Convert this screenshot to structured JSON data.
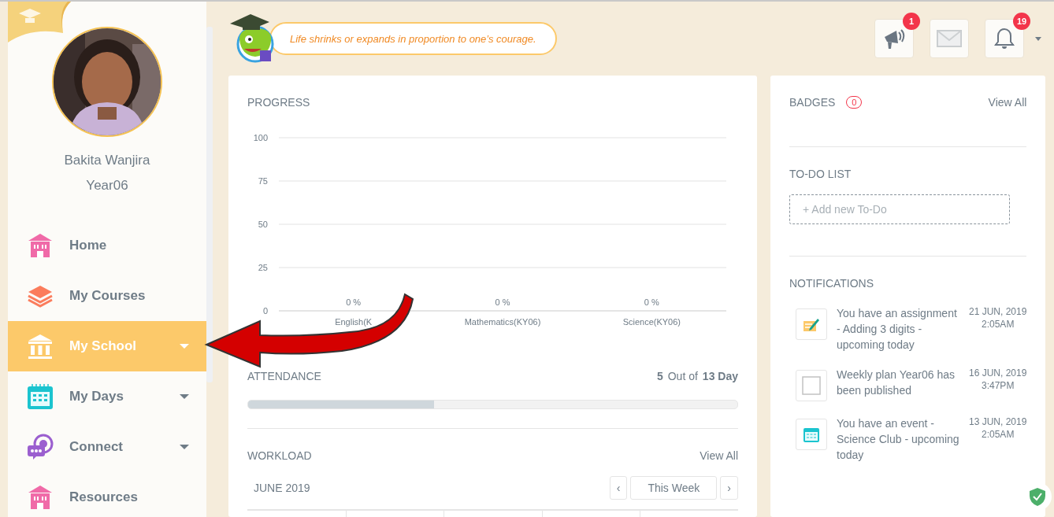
{
  "profile": {
    "name": "Bakita Wanjira",
    "class": "Year06"
  },
  "sidebar": {
    "items": [
      {
        "label": "Home",
        "selected": false,
        "expandable": false
      },
      {
        "label": "My Courses",
        "selected": false,
        "expandable": false
      },
      {
        "label": "My School",
        "selected": true,
        "expandable": true
      },
      {
        "label": "My Days",
        "selected": false,
        "expandable": true
      },
      {
        "label": "Connect",
        "selected": false,
        "expandable": true
      },
      {
        "label": "Resources",
        "selected": false,
        "expandable": false
      }
    ]
  },
  "header": {
    "quote": "Life shrinks or expands in proportion to one’s courage.",
    "buttons": [
      {
        "kind": "announcements",
        "badge": "1"
      },
      {
        "kind": "messages"
      },
      {
        "kind": "notifications",
        "badge": "19"
      }
    ]
  },
  "progress": {
    "title": "PROGRESS",
    "chart_data": {
      "type": "bar",
      "categories": [
        "English(K",
        "Mathematics(KY06)",
        "Science(KY06)"
      ],
      "values": [
        0,
        0,
        0
      ],
      "grid": true,
      "ylim": [
        0,
        100
      ],
      "yticks": [
        0,
        25,
        50,
        75,
        100
      ],
      "value_labels": [
        "0 %",
        "0 %",
        "0 %"
      ]
    }
  },
  "attendance": {
    "title": "ATTENDANCE",
    "present": "5",
    "separator": "Out of",
    "total": "13 Day",
    "level": 0.38
  },
  "workload": {
    "title": "WORKLOAD",
    "view_all": "View All",
    "month": "JUNE 2019",
    "period": "This Week",
    "prev": "‹",
    "next": "›"
  },
  "badges": {
    "title": "BADGES",
    "count": "0",
    "view_all": "View All"
  },
  "todo": {
    "title": "TO-DO LIST",
    "placeholder": "+ Add new To-Do"
  },
  "notifications": {
    "title": "NOTIFICATIONS",
    "items": [
      {
        "text": "You have an assignment - Adding 3 digits - upcoming today",
        "date": "21 JUN, 2019",
        "time": "2:05AM"
      },
      {
        "text": "Weekly plan Year06 has been published",
        "date": "16 JUN, 2019",
        "time": "3:47PM"
      },
      {
        "text": "You have an event - Science Club - upcoming today",
        "date": "13 JUN, 2019",
        "time": "2:05AM"
      }
    ]
  }
}
